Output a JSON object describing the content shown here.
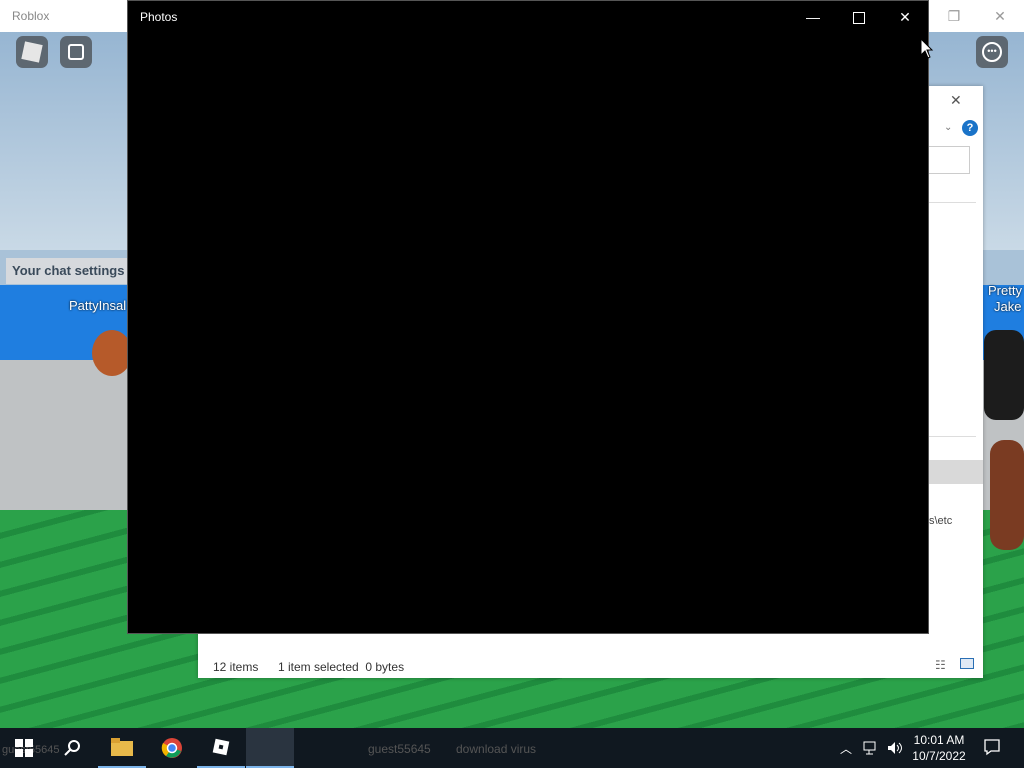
{
  "roblox": {
    "window_title": "Roblox",
    "chat_settings_text": "Your chat settings",
    "players": [
      "PattyInsal",
      "Pretty",
      "Jake"
    ],
    "bottom_names": [
      "guest55645",
      "download virus"
    ]
  },
  "explorer": {
    "items_count": "12 items",
    "selection": "1 item selected  0 bytes",
    "path_fragment": "s\\etc"
  },
  "photos": {
    "title": "Photos"
  },
  "taskbar": {
    "time": "10:01 AM",
    "date": "10/7/2022"
  },
  "colors": {
    "taskbar_bg": "#101820",
    "photos_bg": "#000000",
    "help_blue": "#1a73c8"
  }
}
